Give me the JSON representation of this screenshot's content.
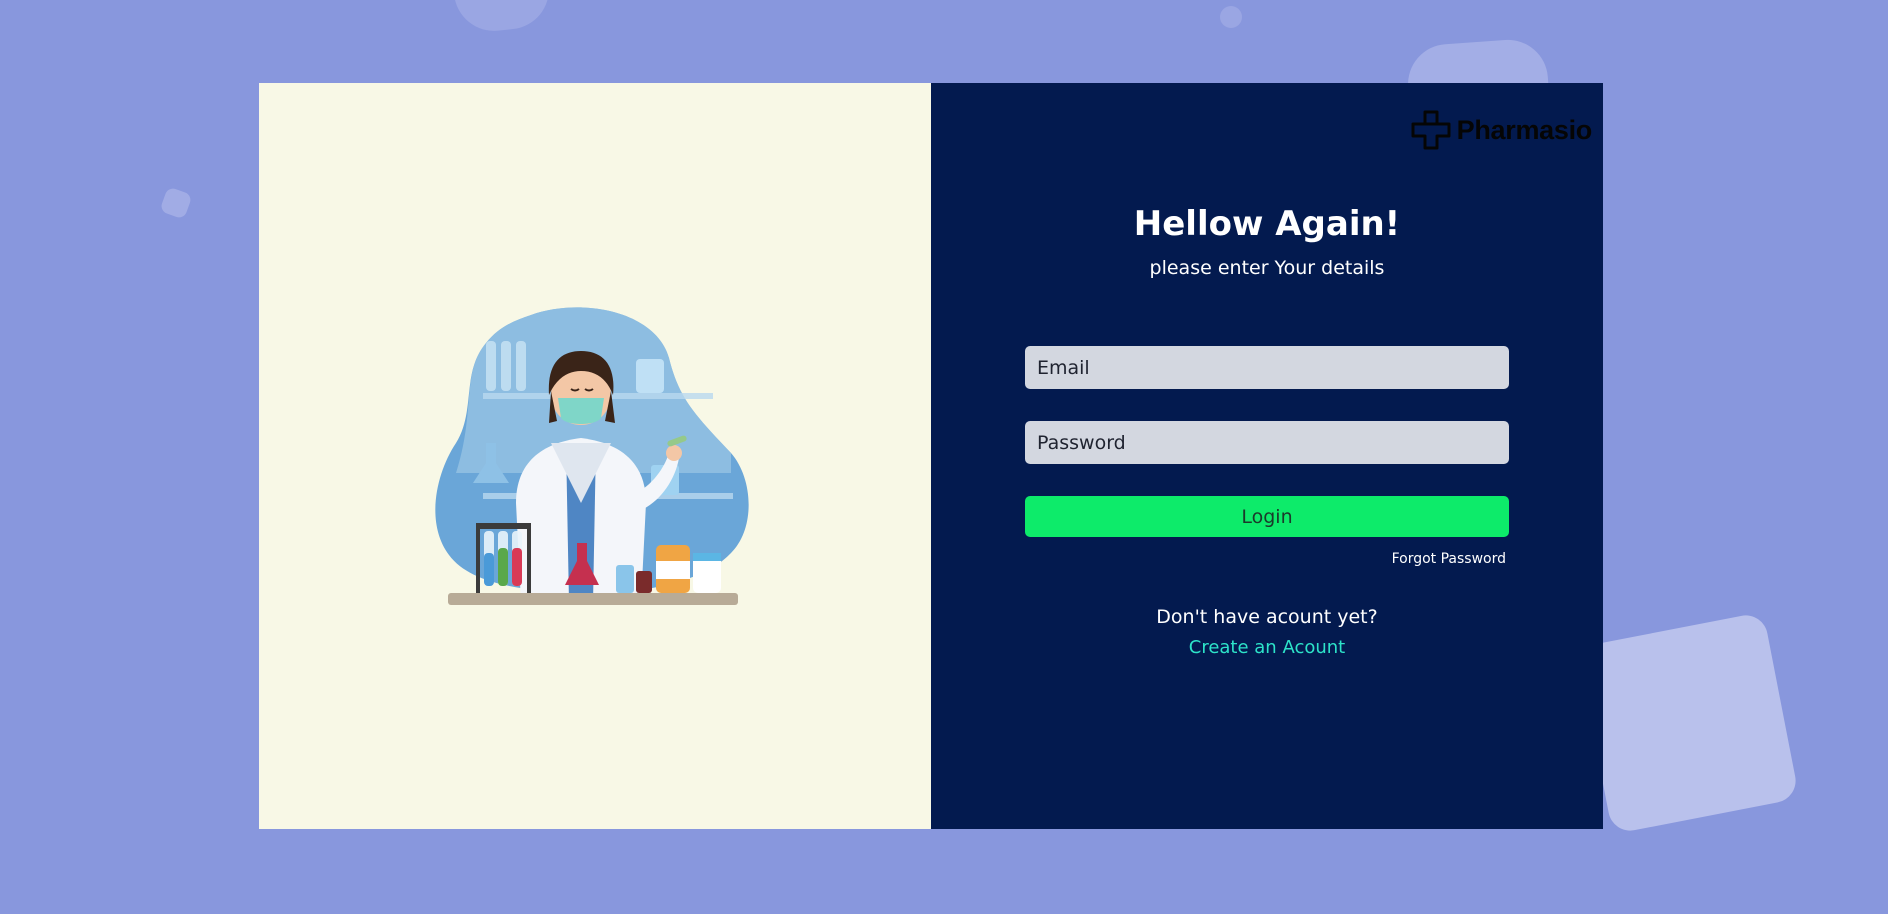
{
  "brand": {
    "name": "Pharmasio",
    "logo_icon": "medical-cross-icon"
  },
  "login": {
    "heading": "Hellow Again!",
    "subheading": "please enter Your details",
    "email_placeholder": "Email",
    "password_placeholder": "Password",
    "login_label": "Login",
    "forgot_password_label": "Forgot Password",
    "no_account_text": "Don't have acount yet?",
    "create_account_label": "Create an Acount"
  },
  "illustration": {
    "subject": "pharmacist-illustration"
  },
  "colors": {
    "background": "#8897dd",
    "left_panel": "#f8f8e6",
    "right_panel": "#031a4f",
    "input_bg": "#d3d7e0",
    "login_button": "#0deb6a",
    "link_accent": "#2de3c9"
  }
}
